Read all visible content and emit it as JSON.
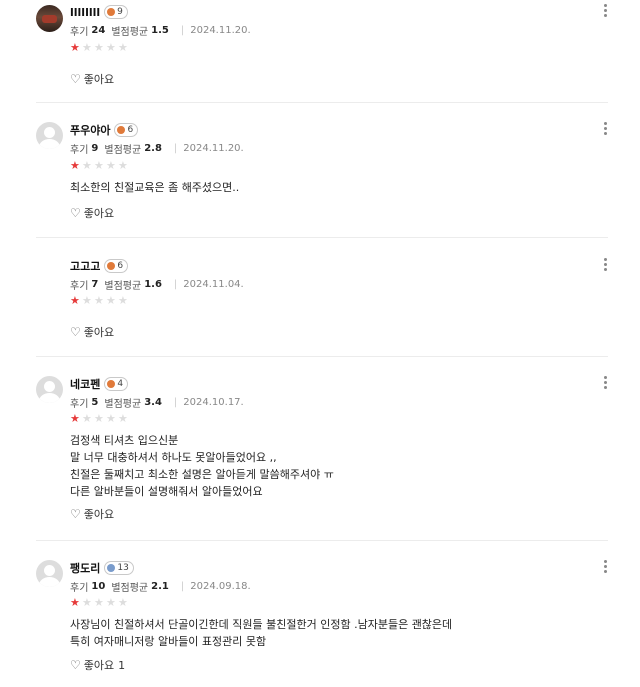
{
  "reviews": [
    {
      "name": "llllllll",
      "badge": "9",
      "badge_color": "orange",
      "review_label": "후기",
      "review_count": "24",
      "avg_label": "별점평균",
      "avg": "1.5",
      "date": "2024.11.20.",
      "rating": 1,
      "text_lines": [],
      "like_label": "좋아요",
      "like_count": ""
    },
    {
      "name": "푸우야아",
      "badge": "6",
      "badge_color": "orange",
      "review_label": "후기",
      "review_count": "9",
      "avg_label": "별점평균",
      "avg": "2.8",
      "date": "2024.11.20.",
      "rating": 1,
      "text_lines": [
        "최소한의 친절교육은 좀 해주셨으면.."
      ],
      "like_label": "좋아요",
      "like_count": ""
    },
    {
      "name": "고고고",
      "badge": "6",
      "badge_color": "orange",
      "review_label": "후기",
      "review_count": "7",
      "avg_label": "별점평균",
      "avg": "1.6",
      "date": "2024.11.04.",
      "rating": 1,
      "text_lines": [],
      "like_label": "좋아요",
      "like_count": ""
    },
    {
      "name": "네코펜",
      "badge": "4",
      "badge_color": "orange",
      "review_label": "후기",
      "review_count": "5",
      "avg_label": "별점평균",
      "avg": "3.4",
      "date": "2024.10.17.",
      "rating": 1,
      "text_lines": [
        "검정색 티셔츠 입으신분",
        "말 너무 대충하셔서 하나도 못알아들었어요 ,,",
        "친절은 둘째치고 최소한 설명은 알아듣게 말씀해주셔야 ㅠ",
        "다른 알바분들이 설명해줘서 알아들었어요"
      ],
      "like_label": "좋아요",
      "like_count": ""
    },
    {
      "name": "팽도리",
      "badge": "13",
      "badge_color": "blue",
      "review_label": "후기",
      "review_count": "10",
      "avg_label": "별점평균",
      "avg": "2.1",
      "date": "2024.09.18.",
      "rating": 1,
      "text_lines": [
        "사장님이 친절하셔서 단골이긴한데 직원들 불친절한거 인정함 .남자분들은 괜찮은데",
        "특히 여자매니저랑 알바들이 표정관리 못함"
      ],
      "like_label": "좋아요",
      "like_count": "1"
    }
  ],
  "colors": {
    "star_on": "#e63a3a",
    "star_off": "#dddddd",
    "badge_orange": "#e07a3a",
    "badge_blue": "#7a9ccc"
  },
  "icons": {
    "more": "more-vertical-icon",
    "like": "heart-outline-icon",
    "star": "star-icon"
  }
}
